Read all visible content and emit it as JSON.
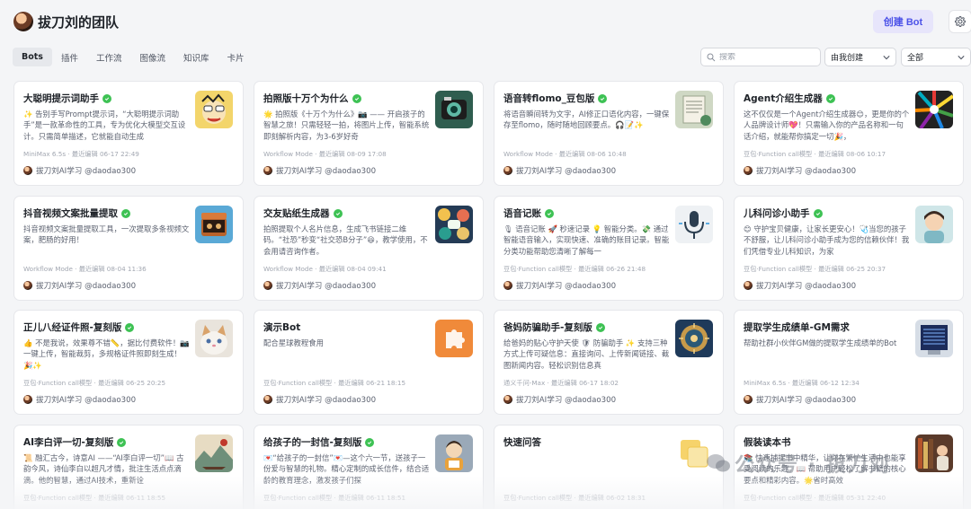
{
  "header": {
    "team_name": "拔刀刘的团队",
    "create_button": "创建 Bot",
    "settings_icon": "gear-icon"
  },
  "tabs": [
    {
      "label": "Bots",
      "active": true
    },
    {
      "label": "插件",
      "active": false
    },
    {
      "label": "工作流",
      "active": false
    },
    {
      "label": "图像流",
      "active": false
    },
    {
      "label": "知识库",
      "active": false
    },
    {
      "label": "卡片",
      "active": false
    }
  ],
  "filters": {
    "search_placeholder": "搜索",
    "created_by": "由我创建",
    "scope": "全部"
  },
  "owner": "拔刀刘AI学习 @daodao300",
  "cards": [
    {
      "title": "大聪明提示词助手",
      "verified": true,
      "desc": "✨ 告别手写Prompt提示词，“大聪明提示词助手”是一款革命性的工具，专为优化大模型交互设计。只需简单描述，它就能自动生成",
      "meta": "MiniMax 6.5s · 最近编辑 06-17 22:49"
    },
    {
      "title": "拍照版十万个为什么",
      "verified": true,
      "desc": "🌟 拍照版《十万个为什么》📷 —— 开启孩子的智慧之旅！只需轻轻一拍，将图片上传，智能系统即刻解析内容，为3-6岁好奇",
      "meta": "Workflow Mode · 最近编辑 08-09 17:08"
    },
    {
      "title": "语音转flomo_豆包版",
      "verified": true,
      "desc": "将语音瞬间转为文字，AI修正口语化内容，一键保存至flomo，随时随地回顾要点。🎧📝✨",
      "meta": "Workflow Mode · 最近编辑 08-06 10:48"
    },
    {
      "title": "Agent介绍生成器",
      "verified": true,
      "desc": "这不仅仅是一个Agent介绍生成器😊，更是你的个人品牌设计师💖！只需输入你的产品名称和一句话介绍，就能帮你搞定一切🎉，",
      "meta": "豆包·Function call模型 · 最近编辑 08-06 10:17"
    },
    {
      "title": "抖音视频文案批量提取",
      "verified": true,
      "desc": "抖音视频文案批量提取工具，一次提取多条视频文案，肥肠的好用！",
      "meta": "Workflow Mode · 最近编辑 08-04 11:36"
    },
    {
      "title": "交友贴纸生成器",
      "verified": true,
      "desc": "拍照提取个人名片信息，生成飞书链接二维码。“社恐”秒变“社交恐B分子”😆，教学使用，不会用请咨询作者。",
      "meta": "Workflow Mode · 最近编辑 08-04 09:41"
    },
    {
      "title": "语音记账",
      "verified": true,
      "desc": "🎙 语音记账 🚀 秒速记录 💡 智能分类。💸 通过智能语音输入，实现快速、准确的账目记录。智能分类功能帮助您清晰了解每一",
      "meta": "豆包·Function call模型 · 最近编辑 06-26 21:48"
    },
    {
      "title": "儿科问诊小助手",
      "verified": true,
      "desc": "😊 守护宝贝健康，让家长更安心！🩺当您的孩子不舒服，让儿科问诊小助手成为您的信赖伙伴！我们凭借专业儿科知识，为家",
      "meta": "豆包·Function call模型 · 最近编辑 06-25 20:37"
    },
    {
      "title": "正儿八经证件照-复刻版",
      "verified": true,
      "desc": "👍 不是我说，效果尊不错📏，据比付费软件！📷一键上传，智能裁剪，多规格证件照即刻生成！🎉✨",
      "meta": "豆包·Function call模型 · 最近编辑 06-25 20:25"
    },
    {
      "title": "演示Bot",
      "verified": false,
      "desc": "配合星球教程食用",
      "meta": "豆包·Function call模型 · 最近编辑 06-21 18:15"
    },
    {
      "title": "爸妈防骗助手-复刻版",
      "verified": true,
      "desc": "给爸妈的贴心守护天使 🛡 防骗助手 ✨ 支持三种方式上传可疑信息：直接询问、上传新闻链接、截图新闻内容。轻松识别信息真",
      "meta": "通义千问-Max · 最近编辑 06-17 18:02"
    },
    {
      "title": "提取学生成绩单-GM需求",
      "verified": false,
      "desc": "帮助社群小伙伴GM做的提取学生成绩单的Bot",
      "meta": "MiniMax 6.5s · 最近编辑 06-12 12:34"
    },
    {
      "title": "AI李白评一切-复刻版",
      "verified": true,
      "desc": "📜 融汇古今，诗意AI ——“AI李白评一切”📖 古韵今风，诗仙李白以超凡才情，批注生活点点滴滴。他的智慧，通过AI技术，重新诠",
      "meta": "豆包·Function call模型 · 最近编辑 06-11 18:55"
    },
    {
      "title": "给孩子的一封信-复刻版",
      "verified": true,
      "desc": "💌“给孩子的一封信”💌—这个六一节，送孩子一份爱与智慧的礼物。精心定制的成长信件，结合适龄的教育理念，激发孩子们探",
      "meta": "豆包·Function call模型 · 最近编辑 06-11 18:51"
    },
    {
      "title": "快速问答",
      "verified": false,
      "desc": "",
      "meta": "豆包·Function call模型 · 最近编辑 06-02 18:31"
    },
    {
      "title": "假装读本书",
      "verified": false,
      "desc": "📚 快速捕捉书中精华，让你在繁忙生活中也能享受阅读的乐趣。📖 帮助用户轻松了解书籍的核心要点和精彩内容。🌟省时高效",
      "meta": "豆包·Function call模型 · 最近编辑 05-31 22:40"
    }
  ],
  "watermark": "公众号 · 拔刀刘"
}
